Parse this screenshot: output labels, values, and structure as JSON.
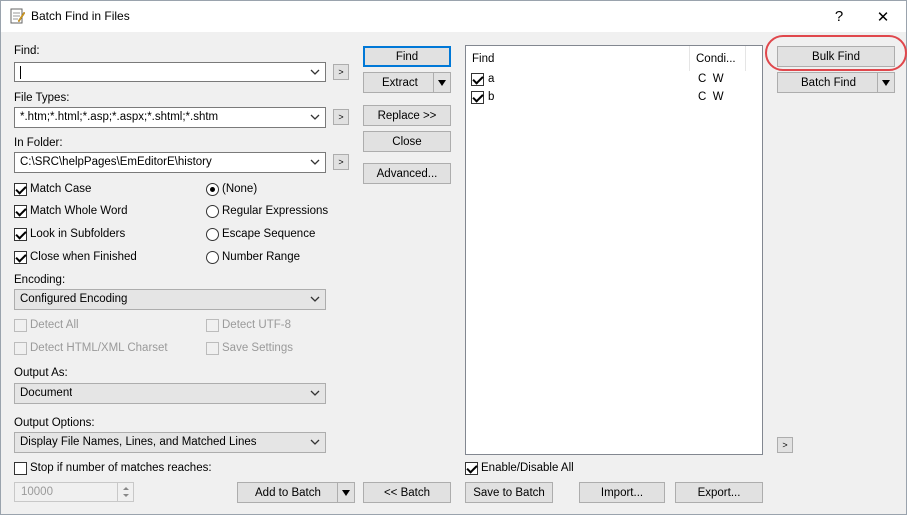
{
  "window": {
    "title": "Batch Find in Files",
    "help": "?",
    "close": "✕"
  },
  "find": {
    "label": "Find:",
    "value": "",
    "filetypes_label": "File Types:",
    "filetypes_value": "*.htm;*.html;*.asp;*.aspx;*.shtml;*.shtm",
    "folder_label": "In Folder:",
    "folder_value": "C:\\SRC\\helpPages\\EmEditorE\\history"
  },
  "options": {
    "match_case": "Match Case",
    "match_whole_word": "Match Whole Word",
    "look_in_subfolders": "Look in Subfolders",
    "close_when_finished": "Close when Finished",
    "none": "(None)",
    "regex": "Regular Expressions",
    "escape": "Escape Sequence",
    "number_range": "Number Range"
  },
  "encoding": {
    "label": "Encoding:",
    "value": "Configured Encoding",
    "detect_all": "Detect All",
    "detect_utf8": "Detect UTF-8",
    "detect_html": "Detect HTML/XML Charset",
    "save_settings": "Save Settings"
  },
  "output": {
    "as_label": "Output As:",
    "as_value": "Document",
    "options_label": "Output Options:",
    "options_value": "Display File Names, Lines, and Matched Lines",
    "stop_label": "Stop if number of matches reaches:",
    "stop_value": "10000"
  },
  "buttons": {
    "find": "Find",
    "extract": "Extract",
    "replace": "Replace >>",
    "close": "Close",
    "advanced": "Advanced...",
    "add_to_batch": "Add to Batch",
    "back_batch": "<< Batch",
    "save_to_batch": "Save to Batch",
    "import": "Import...",
    "export": "Export...",
    "bulk_find": "Bulk Find",
    "batch_find": "Batch Find",
    "arrow": ">"
  },
  "batch_list": {
    "col_find": "Find",
    "col_cond": "Condi...",
    "rows": [
      {
        "find": "a",
        "cond": "C  W"
      },
      {
        "find": "b",
        "cond": "C  W"
      }
    ],
    "enable_all": "Enable/Disable All"
  }
}
